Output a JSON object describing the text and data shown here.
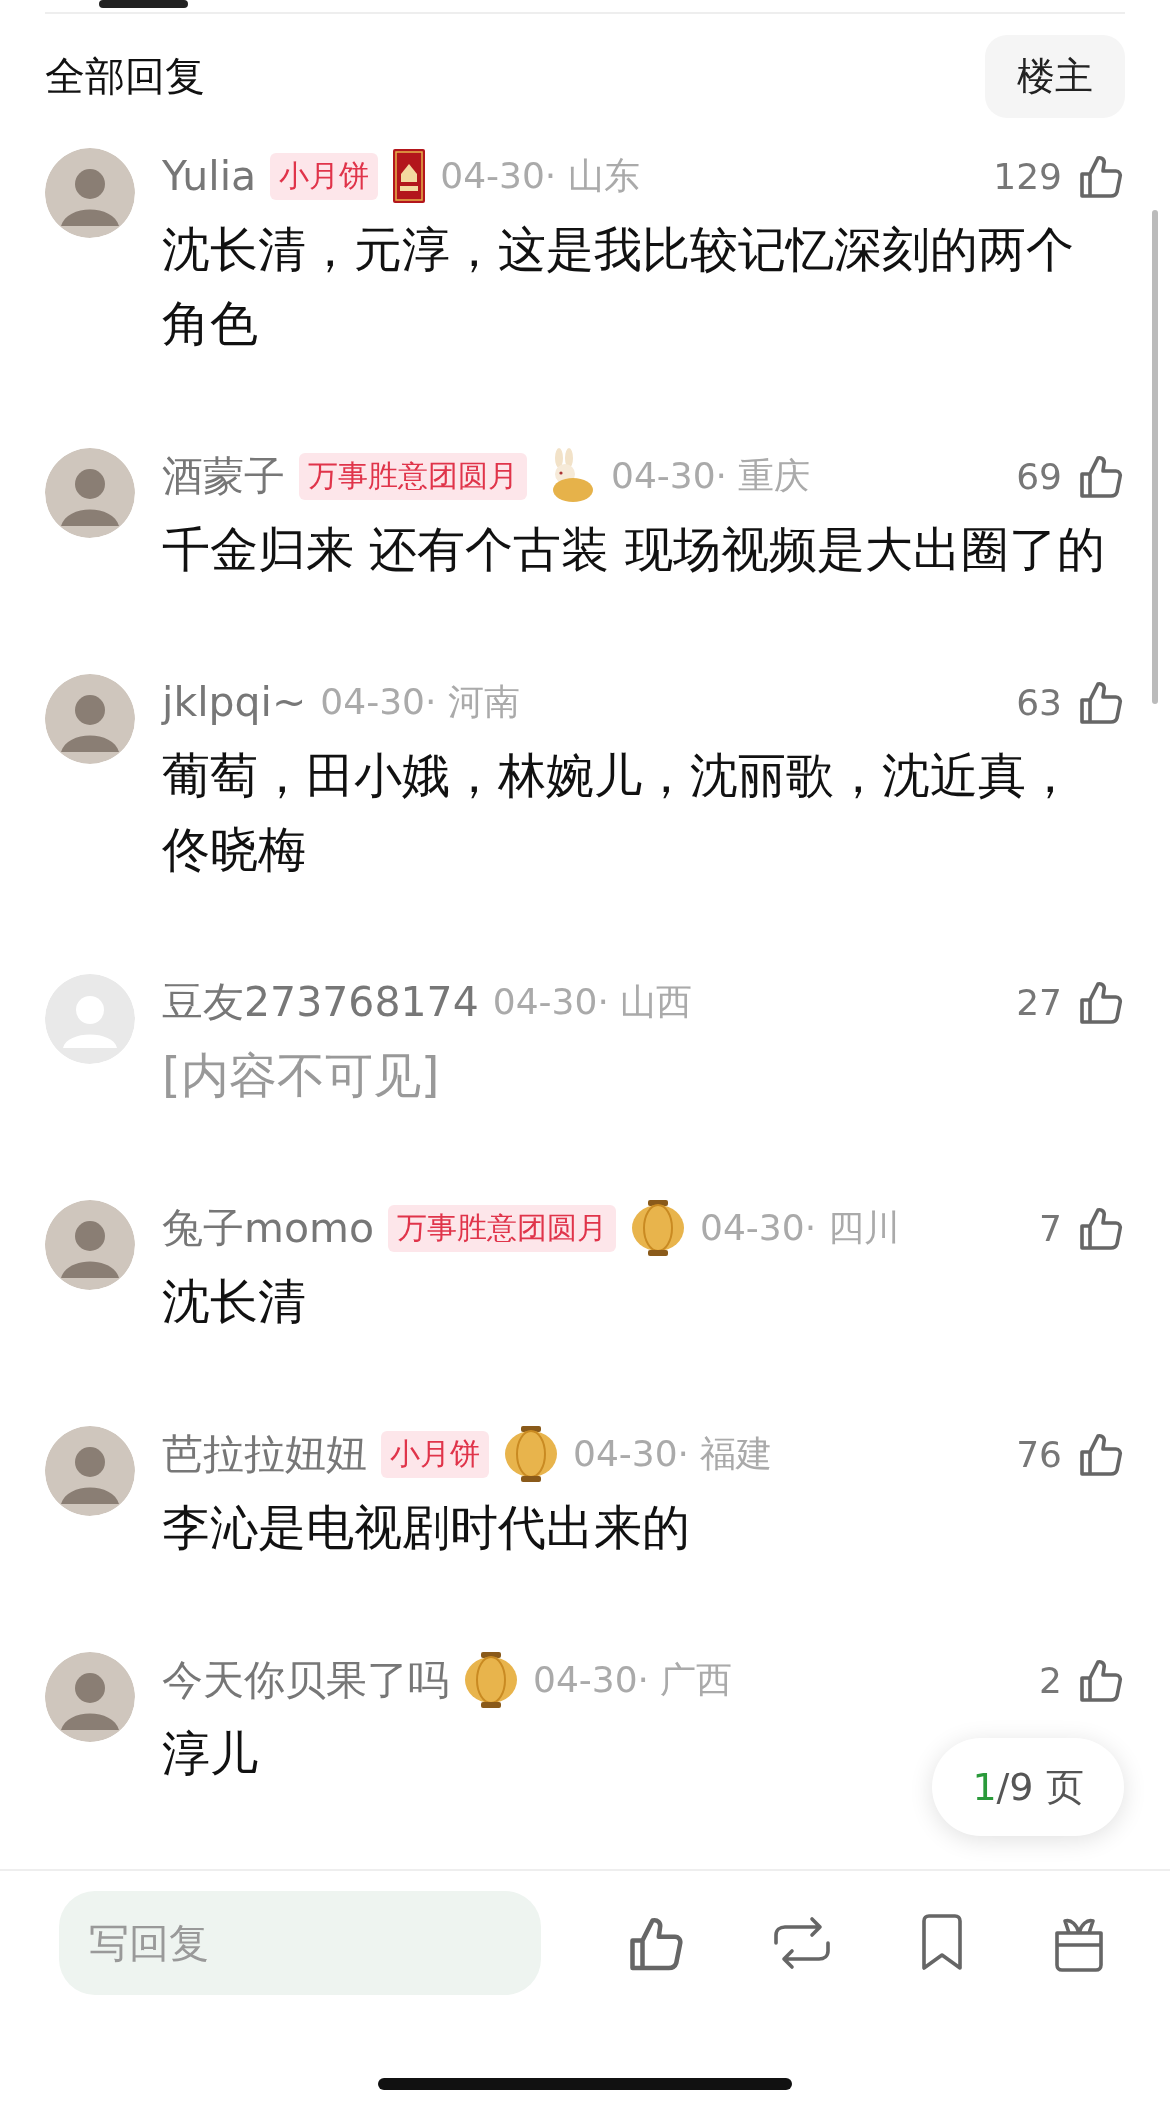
{
  "header": {
    "title": "全部回复",
    "filter_button": "楼主"
  },
  "comments": [
    {
      "user": "Yulia",
      "avatar": {
        "kind": "photo"
      },
      "badge": "小月饼",
      "decoration": {
        "kind": "card"
      },
      "meta": "04-30· 山东",
      "likes": "129",
      "text": "沈长清，元淳，这是我比较记忆深刻的两个角色",
      "hidden": false
    },
    {
      "user": "酒蒙子",
      "avatar": {
        "kind": "photo"
      },
      "badge": "万事胜意团圆月",
      "decoration": {
        "kind": "rabbit"
      },
      "meta": "04-30· 重庆",
      "likes": "69",
      "text": "千金归来 还有个古装 现场视频是大出圈了的",
      "hidden": false
    },
    {
      "user": "jklpqi~",
      "avatar": {
        "kind": "photo"
      },
      "meta": "04-30· 河南",
      "likes": "63",
      "text": "葡萄，田小娥，林婉儿，沈丽歌，沈近真，佟晓梅",
      "hidden": false
    },
    {
      "user": "豆友273768174",
      "avatar": {
        "kind": "default"
      },
      "meta": "04-30· 山西",
      "likes": "27",
      "text": "[内容不可见]",
      "hidden": true
    },
    {
      "user": "兔子momo",
      "avatar": {
        "kind": "photo"
      },
      "badge": "万事胜意团圆月",
      "decoration": {
        "kind": "lantern"
      },
      "meta": "04-30· 四川",
      "likes": "7",
      "text": "沈长清",
      "hidden": false
    },
    {
      "user": "芭拉拉妞妞",
      "avatar": {
        "kind": "photo"
      },
      "badge": "小月饼",
      "decoration": {
        "kind": "lantern"
      },
      "meta": "04-30· 福建",
      "likes": "76",
      "text": "李沁是电视剧时代出来的",
      "hidden": false
    },
    {
      "user": "今天你贝果了吗",
      "avatar": {
        "kind": "photo"
      },
      "decoration": {
        "kind": "lantern"
      },
      "meta": "04-30· 广西",
      "likes": "2",
      "text": "淳儿",
      "hidden": false
    }
  ],
  "pager": {
    "current": "1",
    "rest": "/9 页"
  },
  "reply_bar": {
    "placeholder": "写回复"
  }
}
